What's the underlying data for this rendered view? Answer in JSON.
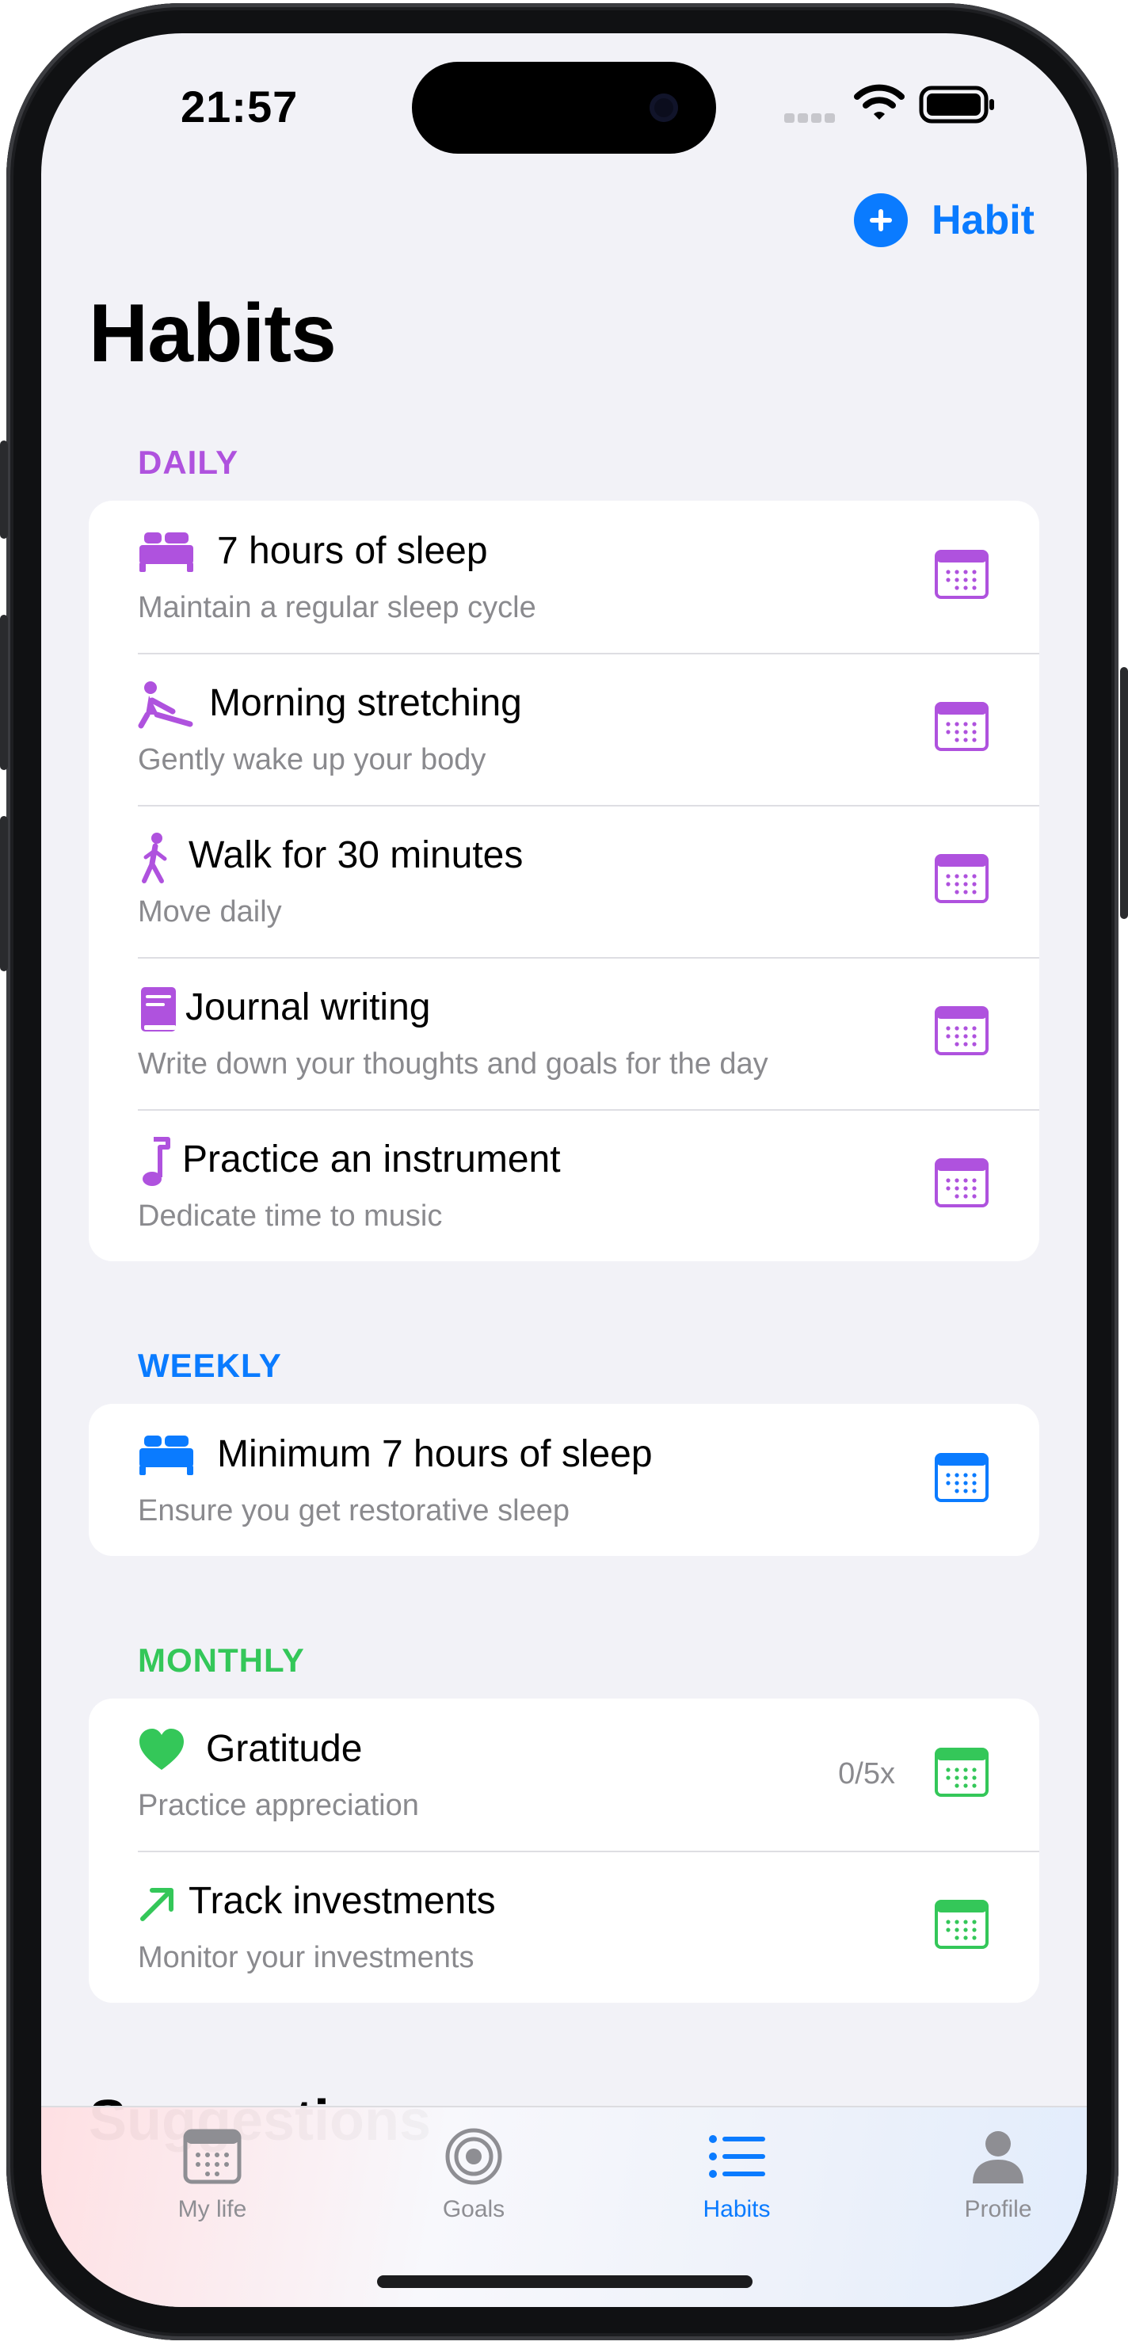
{
  "status_bar": {
    "time": "21:57"
  },
  "header": {
    "add_label": "Habit",
    "title": "Habits"
  },
  "colors": {
    "daily": "#af52de",
    "weekly": "#0a7bff",
    "monthly": "#34c759",
    "accent": "#0a7bff"
  },
  "sections": {
    "daily": {
      "label": "DAILY",
      "items": [
        {
          "icon": "bed-icon",
          "title": "7 hours of sleep",
          "subtitle": "Maintain a regular sleep cycle"
        },
        {
          "icon": "stretching-icon",
          "title": "Morning stretching",
          "subtitle": "Gently wake up your body"
        },
        {
          "icon": "walking-icon",
          "title": "Walk for 30 minutes",
          "subtitle": "Move daily"
        },
        {
          "icon": "book-icon",
          "title": "Journal writing",
          "subtitle": "Write down your thoughts and goals for the day"
        },
        {
          "icon": "music-note-icon",
          "title": "Practice an instrument",
          "subtitle": "Dedicate time to music"
        }
      ]
    },
    "weekly": {
      "label": "WEEKLY",
      "items": [
        {
          "icon": "bed-icon",
          "title": "Minimum 7 hours of sleep",
          "subtitle": "Ensure you get restorative sleep"
        }
      ]
    },
    "monthly": {
      "label": "MONTHLY",
      "items": [
        {
          "icon": "heart-icon",
          "title": "Gratitude",
          "subtitle": "Practice appreciation",
          "count": "0/5x"
        },
        {
          "icon": "arrow-up-right-icon",
          "title": "Track investments",
          "subtitle": "Monitor your investments"
        }
      ]
    }
  },
  "more_section": {
    "title": "Suggestions"
  },
  "tabbar": {
    "tabs": [
      {
        "icon": "calendar-icon",
        "label": "My life"
      },
      {
        "icon": "target-icon",
        "label": "Goals"
      },
      {
        "icon": "list-icon",
        "label": "Habits",
        "active": true
      },
      {
        "icon": "person-icon",
        "label": "Profile"
      }
    ]
  }
}
